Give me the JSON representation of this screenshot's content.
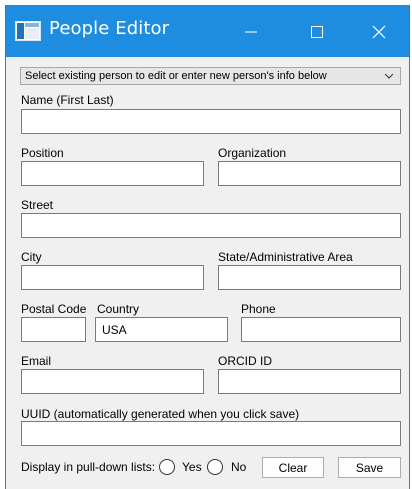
{
  "window": {
    "title": "People Editor"
  },
  "person_select": {
    "selected": "Select existing person to edit or enter new person's info below"
  },
  "labels": {
    "name": "Name (First Last)",
    "position": "Position",
    "organization": "Organization",
    "street": "Street",
    "city": "City",
    "state": "State/Administrative Area",
    "postal_code": "Postal Code",
    "country": "Country",
    "phone": "Phone",
    "email": "Email",
    "orcid": "ORCID ID",
    "uuid": "UUID (automatically generated when you click save)",
    "display_in_lists": "Display in pull-down lists:",
    "yes": "Yes",
    "no": "No"
  },
  "values": {
    "name": "",
    "position": "",
    "organization": "",
    "street": "",
    "city": "",
    "state": "",
    "postal_code": "",
    "country": "USA",
    "phone": "",
    "email": "",
    "orcid": "",
    "uuid": ""
  },
  "buttons": {
    "clear": "Clear",
    "save": "Save"
  },
  "colors": {
    "titlebar": "#1f8ddf",
    "window_bg": "#f0f0f0"
  }
}
